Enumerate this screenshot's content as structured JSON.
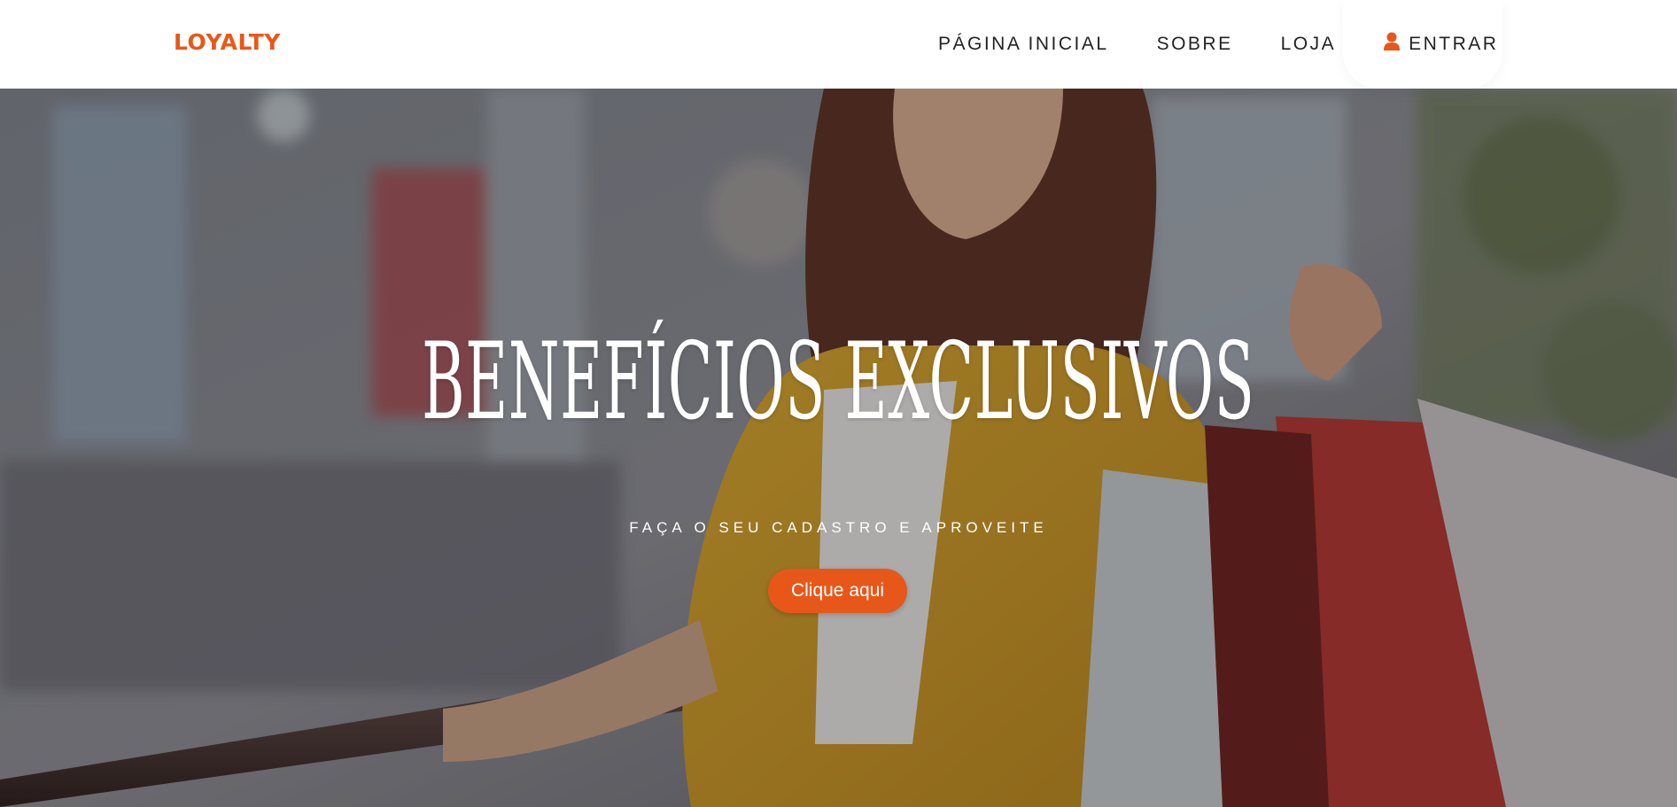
{
  "brand": {
    "name": "LOYALTY",
    "color": "#e8571a"
  },
  "nav": {
    "items": [
      {
        "label": "PÁGINA INICIAL"
      },
      {
        "label": "SOBRE"
      },
      {
        "label": "LOJA"
      }
    ],
    "login": {
      "label": "ENTRAR",
      "icon": "user-icon"
    }
  },
  "hero": {
    "title": "BENEFÍCIOS EXCLUSIVOS",
    "subtitle": "FAÇA O SEU CADASTRO E APROVEITE",
    "cta_label": "Clique aqui",
    "image": "woman-shopping-bags-photo"
  },
  "colors": {
    "accent": "#e8571a",
    "nav_text": "#222222",
    "hero_text": "#ffffff"
  }
}
